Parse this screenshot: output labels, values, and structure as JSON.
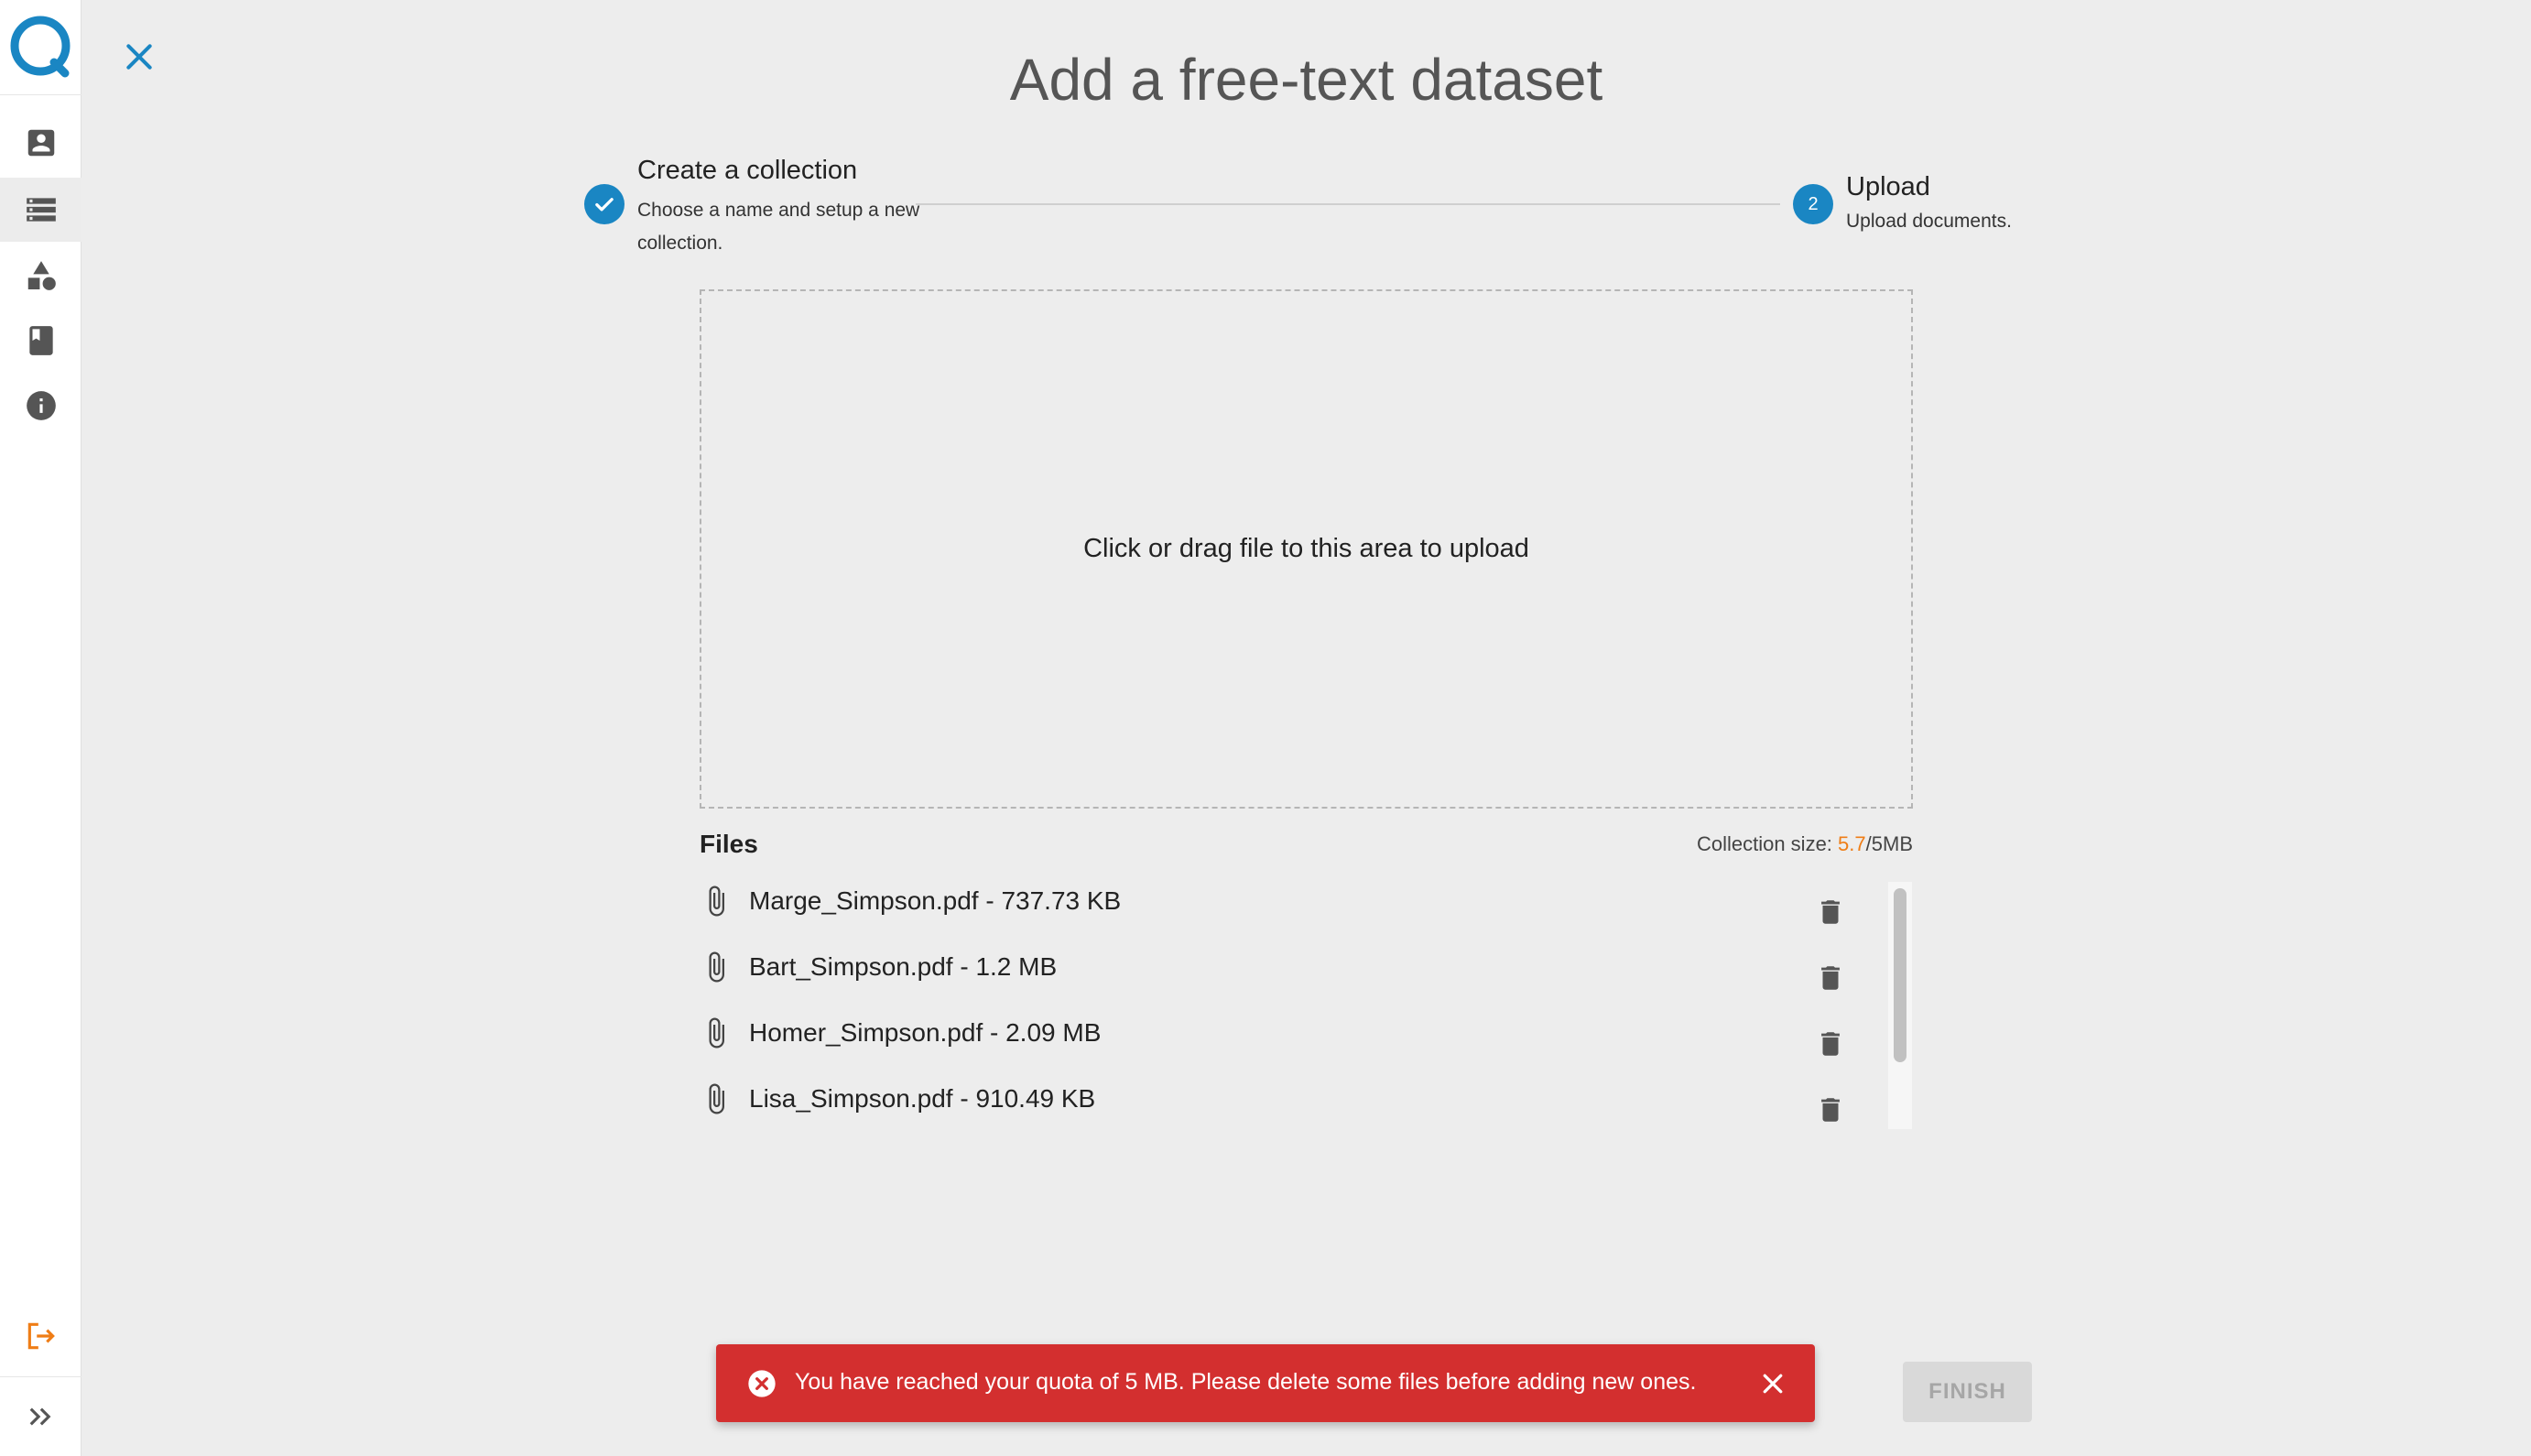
{
  "page": {
    "title": "Add a free-text dataset"
  },
  "sidebar": {
    "items": [
      {
        "icon": "account-box-icon"
      },
      {
        "icon": "storage-icon",
        "active": true
      },
      {
        "icon": "shapes-icon"
      },
      {
        "icon": "book-icon"
      },
      {
        "icon": "info-icon"
      }
    ],
    "logout_icon": "logout-icon",
    "expand_icon": "double-chevron-right-icon"
  },
  "stepper": {
    "step1": {
      "title": "Create a collection",
      "description": "Choose a name and setup a new collection.",
      "status": "completed"
    },
    "step2": {
      "number": "2",
      "title": "Upload",
      "description": "Upload documents.",
      "status": "active"
    }
  },
  "dropzone": {
    "text": "Click or drag file to this area to upload"
  },
  "files": {
    "label": "Files",
    "collection_size_label": "Collection size: ",
    "collection_size_used": "5.7",
    "collection_size_limit": "/5MB",
    "items": [
      {
        "name": "Marge_Simpson.pdf - 737.73 KB"
      },
      {
        "name": "Bart_Simpson.pdf - 1.2 MB"
      },
      {
        "name": "Homer_Simpson.pdf - 2.09 MB"
      },
      {
        "name": "Lisa_Simpson.pdf - 910.49 KB"
      }
    ]
  },
  "snackbar": {
    "message": "You have reached your quota of 5 MB. Please delete some files before adding new ones."
  },
  "finish_button": {
    "label": "FINISH",
    "disabled": true
  },
  "colors": {
    "accent": "#1a86c3",
    "error": "#d32f2f",
    "warning": "#ef7d16",
    "logout": "#ef7d16"
  }
}
